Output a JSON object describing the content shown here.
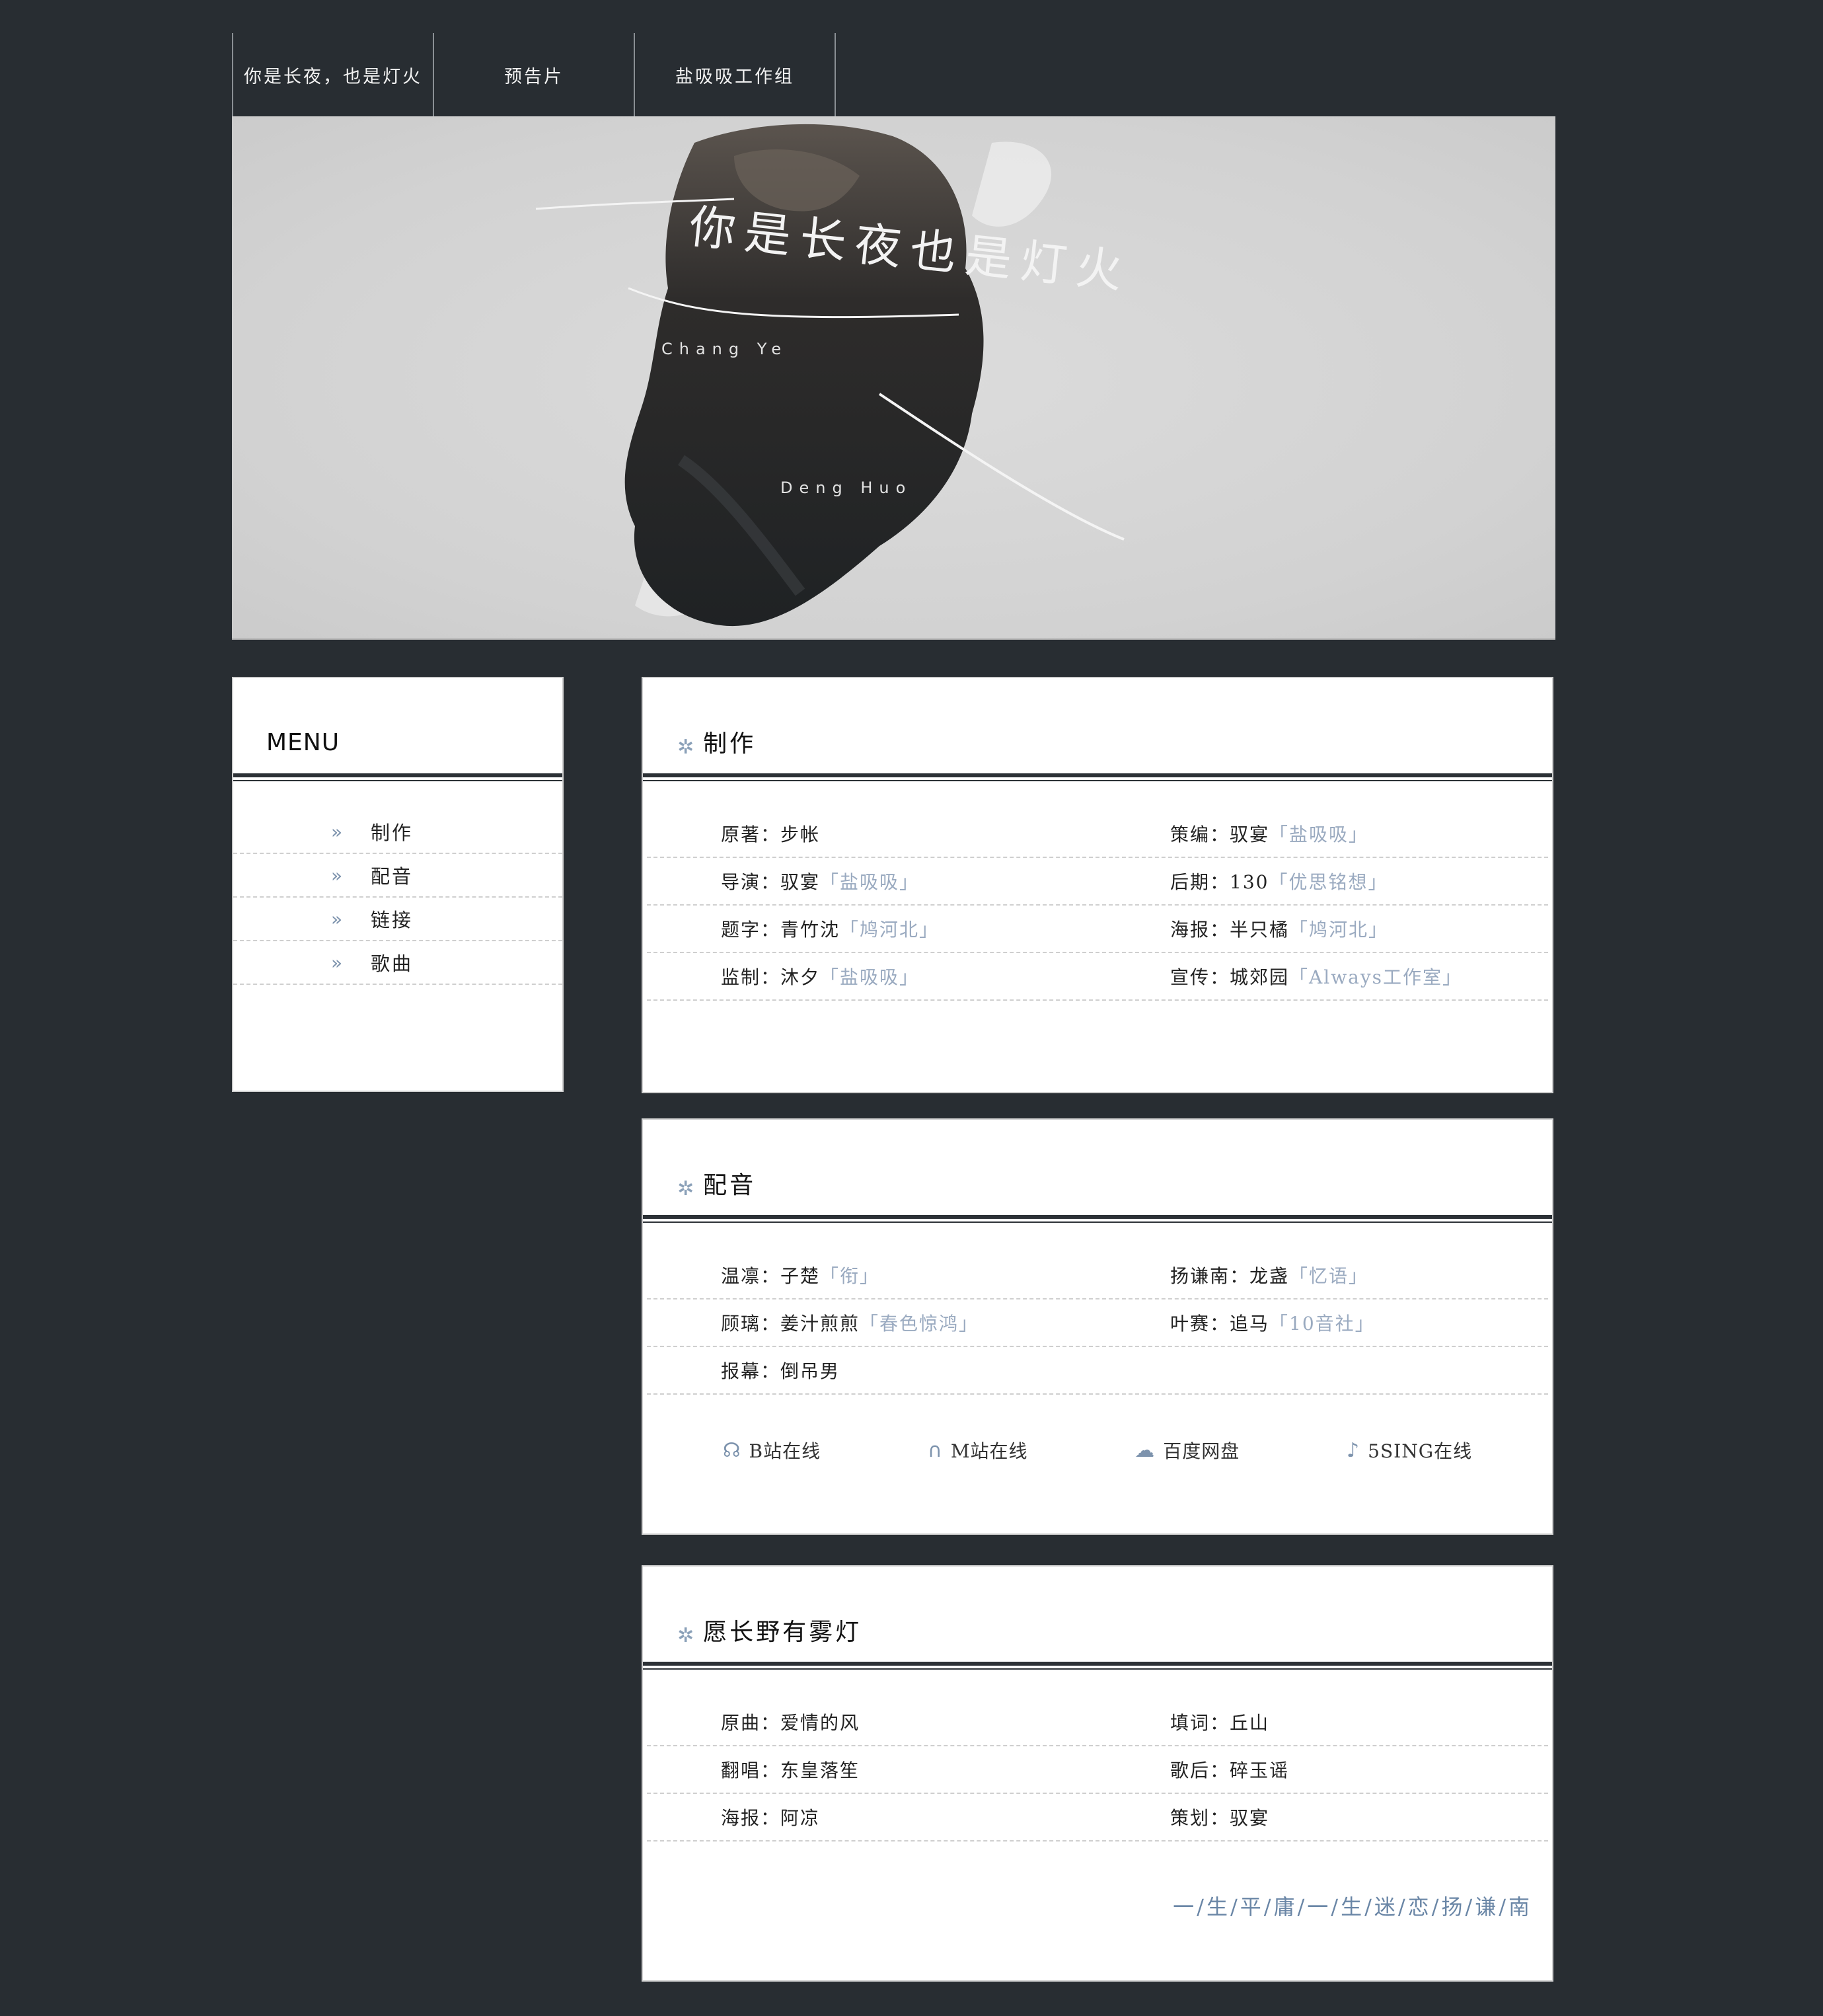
{
  "nav": {
    "tabs": [
      "你是长夜，也是灯火",
      "预告片",
      "盐吸吸工作组"
    ]
  },
  "banner": {
    "title_art": "你是长夜也是灯火",
    "romanized_1": "Chang Ye",
    "romanized_2": "Deng Huo"
  },
  "menu": {
    "title": "MENU",
    "items": [
      "制作",
      "配音",
      "链接",
      "歌曲"
    ]
  },
  "production": {
    "title": "制作",
    "rows": [
      [
        {
          "k": "原著：",
          "v": "步帐",
          "g": ""
        },
        {
          "k": "策编：",
          "v": "驭宴",
          "g": "「盐吸吸」"
        }
      ],
      [
        {
          "k": "导演：",
          "v": "驭宴",
          "g": "「盐吸吸」"
        },
        {
          "k": "后期：",
          "v": "130",
          "g": "「优思铭想」"
        }
      ],
      [
        {
          "k": "题字：",
          "v": "青竹沈",
          "g": "「鸠河北」"
        },
        {
          "k": "海报：",
          "v": "半只橘",
          "g": "「鸠河北」"
        }
      ],
      [
        {
          "k": "监制：",
          "v": "沐夕",
          "g": "「盐吸吸」"
        },
        {
          "k": "宣传：",
          "v": "城郊园",
          "g": "「Always工作室」"
        }
      ]
    ]
  },
  "cast": {
    "title": "配音",
    "rows": [
      [
        {
          "k": "温凛：",
          "v": "子楚",
          "g": "「衔」"
        },
        {
          "k": "扬谦南：",
          "v": "龙盏",
          "g": "「忆语」"
        }
      ],
      [
        {
          "k": "顾璃：",
          "v": "姜汁煎煎",
          "g": "「春色惊鸿」"
        },
        {
          "k": "叶赛：",
          "v": "追马",
          "g": "「10音社」"
        }
      ],
      [
        {
          "k": "报幕：",
          "v": "倒吊男",
          "g": ""
        }
      ]
    ],
    "links": [
      {
        "icon": "bilibili-icon",
        "glyph": "☊",
        "label": "B站在线"
      },
      {
        "icon": "headphones-icon",
        "glyph": "🎧",
        "label": "M站在线"
      },
      {
        "icon": "cloud-upload-icon",
        "glyph": "☁",
        "label": "百度网盘"
      },
      {
        "icon": "music-note-icon",
        "glyph": "♪",
        "label": "5SING在线"
      }
    ]
  },
  "song": {
    "title": "愿长野有雾灯",
    "rows": [
      [
        {
          "k": "原曲：",
          "v": "爱情的风",
          "g": ""
        },
        {
          "k": "填词：",
          "v": "丘山",
          "g": ""
        }
      ],
      [
        {
          "k": "翻唱：",
          "v": "东皇落笙",
          "g": ""
        },
        {
          "k": "歌后：",
          "v": "碎玉谣",
          "g": ""
        }
      ],
      [
        {
          "k": "海报：",
          "v": "阿凉",
          "g": ""
        },
        {
          "k": "策划：",
          "v": "驭宴",
          "g": ""
        }
      ]
    ],
    "motto": "一/生/平/庸/一/生/迷/恋/扬/谦/南"
  },
  "colors": {
    "background": "#282d32",
    "accent": "#7d93ad",
    "muted_value": "#9aaac0"
  }
}
